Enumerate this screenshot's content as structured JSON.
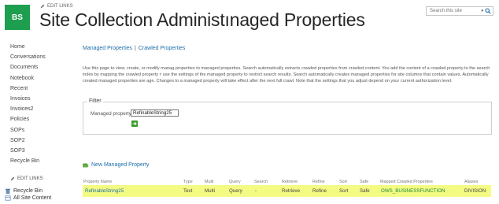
{
  "header": {
    "logo_text": "BS",
    "edit_links": "EDIT LINKS",
    "site_title": "Site Collection Administınaged Properties",
    "search_placeholder": "Search this site",
    "search_dropdown": "▾",
    "brand_color": "#1e9e4f"
  },
  "leftnav": {
    "items": [
      "Home",
      "Conversations",
      "Documents",
      "Notebook",
      "Recent",
      "Invoices",
      "Invoices2",
      "Policies",
      "SOPs",
      "SOP2",
      "SOP3",
      "Recycle Bin"
    ],
    "edit_links": "EDIT LINKS",
    "recycle_bin": "Recycle Bin",
    "all_site_content": "All Site Content"
  },
  "tabs": {
    "managed": "Managed Properties",
    "separator": "|",
    "crawled": "Crawled Properties"
  },
  "description": "Use this page to view, create, or modify manag properties to managed properties. Search automatically extracts crawled properties from crawled content. You add the content of a crawled property to the search index by mapping the crawled property ᴛ use the settings of the managed property to restrict search results. Search automatically creates managed properties for site columns that contain values. Automatically created managed properties are age. Changes to a managed property will take effect after the next full crawl. Note that the settings that you adjust depend on your current authorization level.",
  "filter": {
    "legend": "Filter",
    "label": "Managed property",
    "value": "RefinableString25"
  },
  "new_managed_property": "New Managed Property",
  "table": {
    "headers": [
      "Property Name",
      "Type",
      "Multi",
      "Query",
      "Search",
      "Retrieve",
      "Refine",
      "Sort",
      "Safe",
      "Mapped Crawled Properties",
      "Aliases"
    ],
    "row": [
      "RefinableString25",
      "Text",
      "Multi",
      "Query",
      "-",
      "Retrieve",
      "Refine",
      "Sort",
      "Safe",
      "OWS_BUSINESSFUNCTION",
      "DIVISION"
    ],
    "highlight_color": "#f4fb83"
  }
}
